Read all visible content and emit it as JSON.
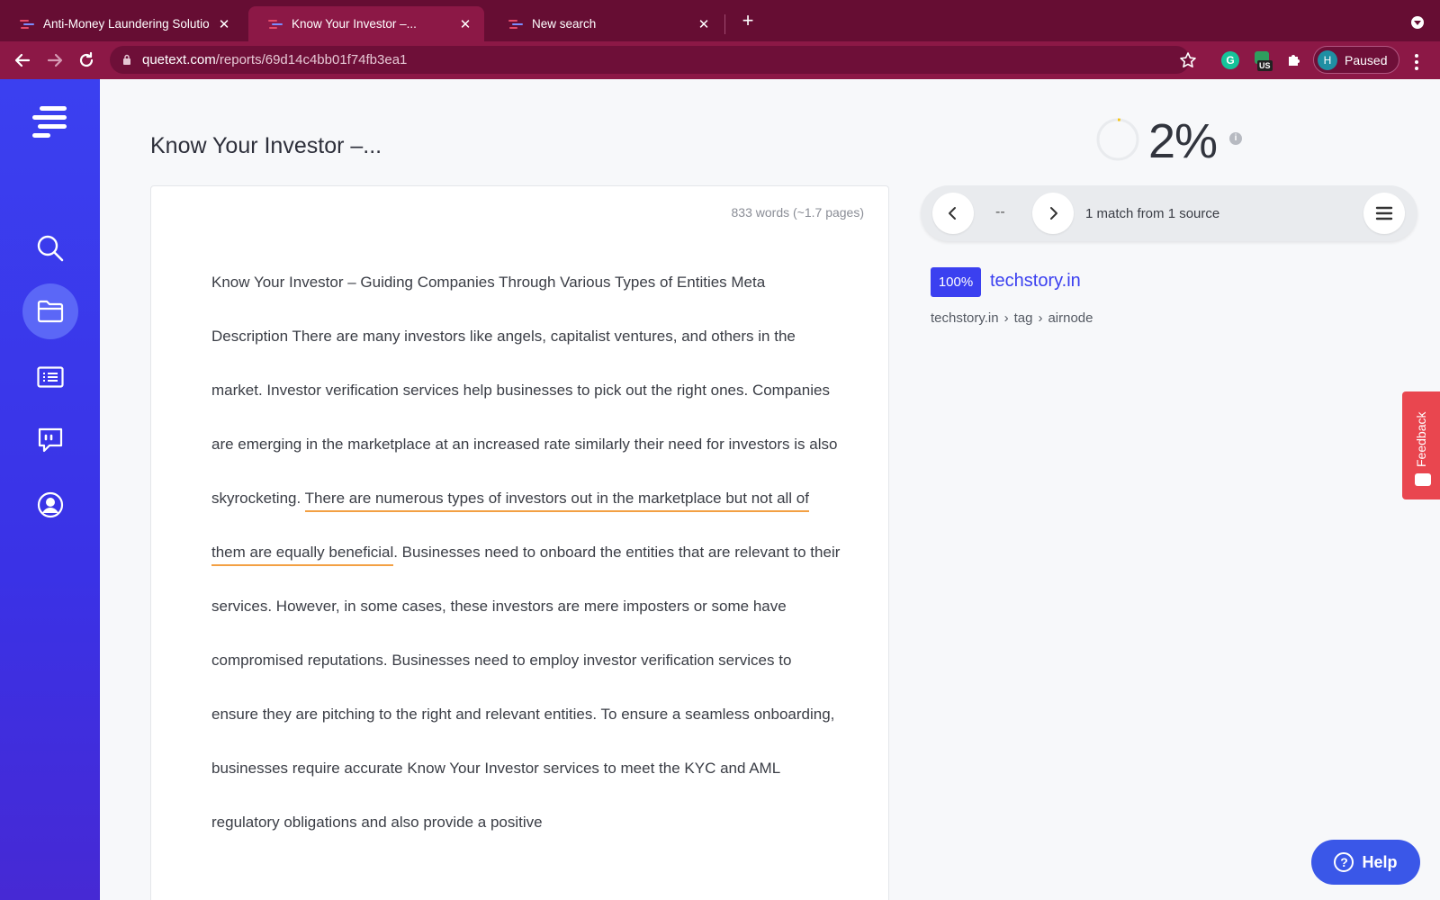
{
  "browser": {
    "tabs": [
      {
        "title": "Anti-Money Laundering Solutio",
        "close": "✕"
      },
      {
        "title": "Know Your Investor –...",
        "close": "✕"
      },
      {
        "title": "New search",
        "close": "✕"
      }
    ],
    "new_tab": "+",
    "url_host": "quetext.com",
    "url_path": "/reports/69d14c4bb01f74fb3ea1",
    "profile_initial": "H",
    "profile_status": "Paused",
    "ext_badge": "US",
    "grammarly_glyph": "G"
  },
  "report": {
    "title": "Know Your Investor –...",
    "word_count": "833 words (~1.7 pages)",
    "score": "2%",
    "info_glyph": "i",
    "paragraph": {
      "pre": "Know Your Investor – Guiding Companies Through Various Types of Entities Meta Description There are many investors like angels, capitalist ventures, and others in the market. Investor verification services help businesses to pick out the right ones. Companies are emerging in the marketplace at an increased rate similarly their need for investors is also skyrocketing. ",
      "highlight": "There are numerous types of investors out in the marketplace but not all of them are equally beneficial",
      "post": ". Businesses need to onboard the entities that are relevant to their services. However, in some cases, these investors are mere imposters or some have compromised reputations. Businesses need to employ investor verification services to ensure they are pitching to the right and relevant entities. To ensure a seamless onboarding, businesses require accurate Know Your Investor services to meet the KYC and AML regulatory obligations and also provide a positive"
    }
  },
  "matches": {
    "position": "--",
    "summary": "1 match from 1 source",
    "source": {
      "percent": "100%",
      "name": "techstory.in",
      "path": [
        "techstory.in",
        "tag",
        "airnode"
      ],
      "path_sep": "›"
    }
  },
  "widgets": {
    "feedback_label": "Feedback",
    "help_label": "Help",
    "help_glyph": "?"
  },
  "colors": {
    "brand": "#3b40f0",
    "highlight": "#f3a043",
    "browser_frame": "#660d33"
  }
}
